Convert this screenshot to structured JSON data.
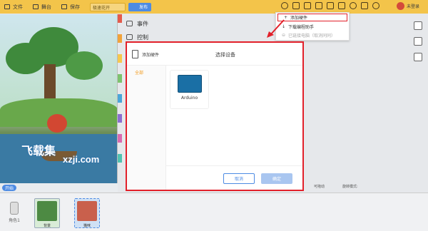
{
  "topbar": {
    "file": "文件",
    "stage": "舞台",
    "save": "保存",
    "project_title": "极速花开",
    "publish": "发布",
    "login": "未登录"
  },
  "block_categories": [
    {
      "label": "事件"
    },
    {
      "label": "控制"
    }
  ],
  "category_colors": [
    "#e45b4b",
    "#f2a33a",
    "#f7c84c",
    "#7cc36d",
    "#4aa6d9",
    "#8b6fd0",
    "#d96ab0",
    "#51c2b0"
  ],
  "dropdown": {
    "items": [
      {
        "label": "添加硬件"
      },
      {
        "label": "下载编程助手"
      },
      {
        "label": "已链接电脑（取消同同）"
      }
    ]
  },
  "dialog": {
    "add_hardware": "添加硬件",
    "title": "选择设备",
    "sidebar_all": "全部",
    "device_name": "Arduino",
    "cancel": "取消",
    "confirm": "确定"
  },
  "stage": {
    "start": "开始",
    "watermark_1": "飞载集",
    "watermark_2": "xzji.com"
  },
  "sprites": {
    "role_label": "角色1",
    "backdrop_label": "背景",
    "sprite_label": "猫咪"
  },
  "bottom_bar": {
    "checkable": "可拖动",
    "rotation": "旋转模式:"
  },
  "colors": {
    "accent": "#f3c44a",
    "primary_blue": "#4d8be3",
    "highlight_red": "#e2202a",
    "selected_orange": "#f29c1f"
  }
}
